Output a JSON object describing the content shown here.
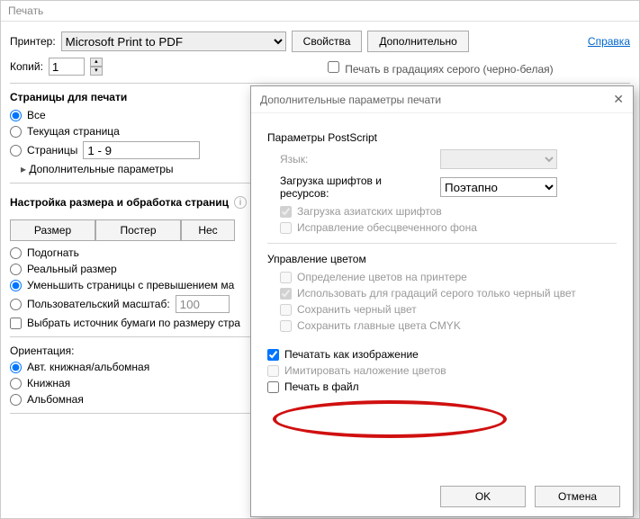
{
  "main": {
    "title": "Печать",
    "printer_label": "Принтер:",
    "printer_value": "Microsoft Print to PDF",
    "properties_btn": "Свойства",
    "advanced_btn": "Дополнительно",
    "help_link": "Справка",
    "copies_label": "Копий:",
    "copies_value": "1",
    "grayscale_partial": "Печать в градациях серого (черно-белая)",
    "pages_header": "Страницы для печати",
    "pages": {
      "all": "Все",
      "current": "Текущая страница",
      "range_label": "Страницы",
      "range_value": "1 - 9",
      "more_params": "Дополнительные параметры"
    },
    "sizing_header": "Настройка размера и обработка страниц",
    "sizing_buttons": {
      "size": "Размер",
      "poster": "Постер",
      "several": "Нес"
    },
    "fit_options": {
      "fit": "Подогнать",
      "actual": "Реальный размер",
      "shrink": "Уменьшить страницы с превышением ма",
      "custom_label": "Пользовательский масштаб:",
      "custom_value": "100"
    },
    "paper_source": "Выбрать источник бумаги по размеру стра",
    "orientation_header": "Ориентация:",
    "orientation": {
      "auto": "Авт. книжная/альбомная",
      "portrait": "Книжная",
      "landscape": "Альбомная"
    }
  },
  "modal": {
    "title": "Дополнительные параметры печати",
    "ps_header": "Параметры PostScript",
    "language_label": "Язык:",
    "fonts_label": "Загрузка шрифтов и ресурсов:",
    "fonts_value": "Поэтапно",
    "asian_fonts": "Загрузка азиатских шрифтов",
    "fix_bleached": "Исправление обесцвеченного фона",
    "color_header": "Управление цветом",
    "color_on_printer": "Определение цветов на принтере",
    "grayscale_black": "Использовать для градаций серого только черный цвет",
    "preserve_black": "Сохранить черный цвет",
    "preserve_cmyk": "Сохранить главные цвета CMYK",
    "print_as_image": "Печатать как изображение",
    "simulate_overprint": "Имитировать наложение цветов",
    "print_to_file": "Печать в файл",
    "ok_btn": "OK",
    "cancel_btn": "Отмена"
  }
}
